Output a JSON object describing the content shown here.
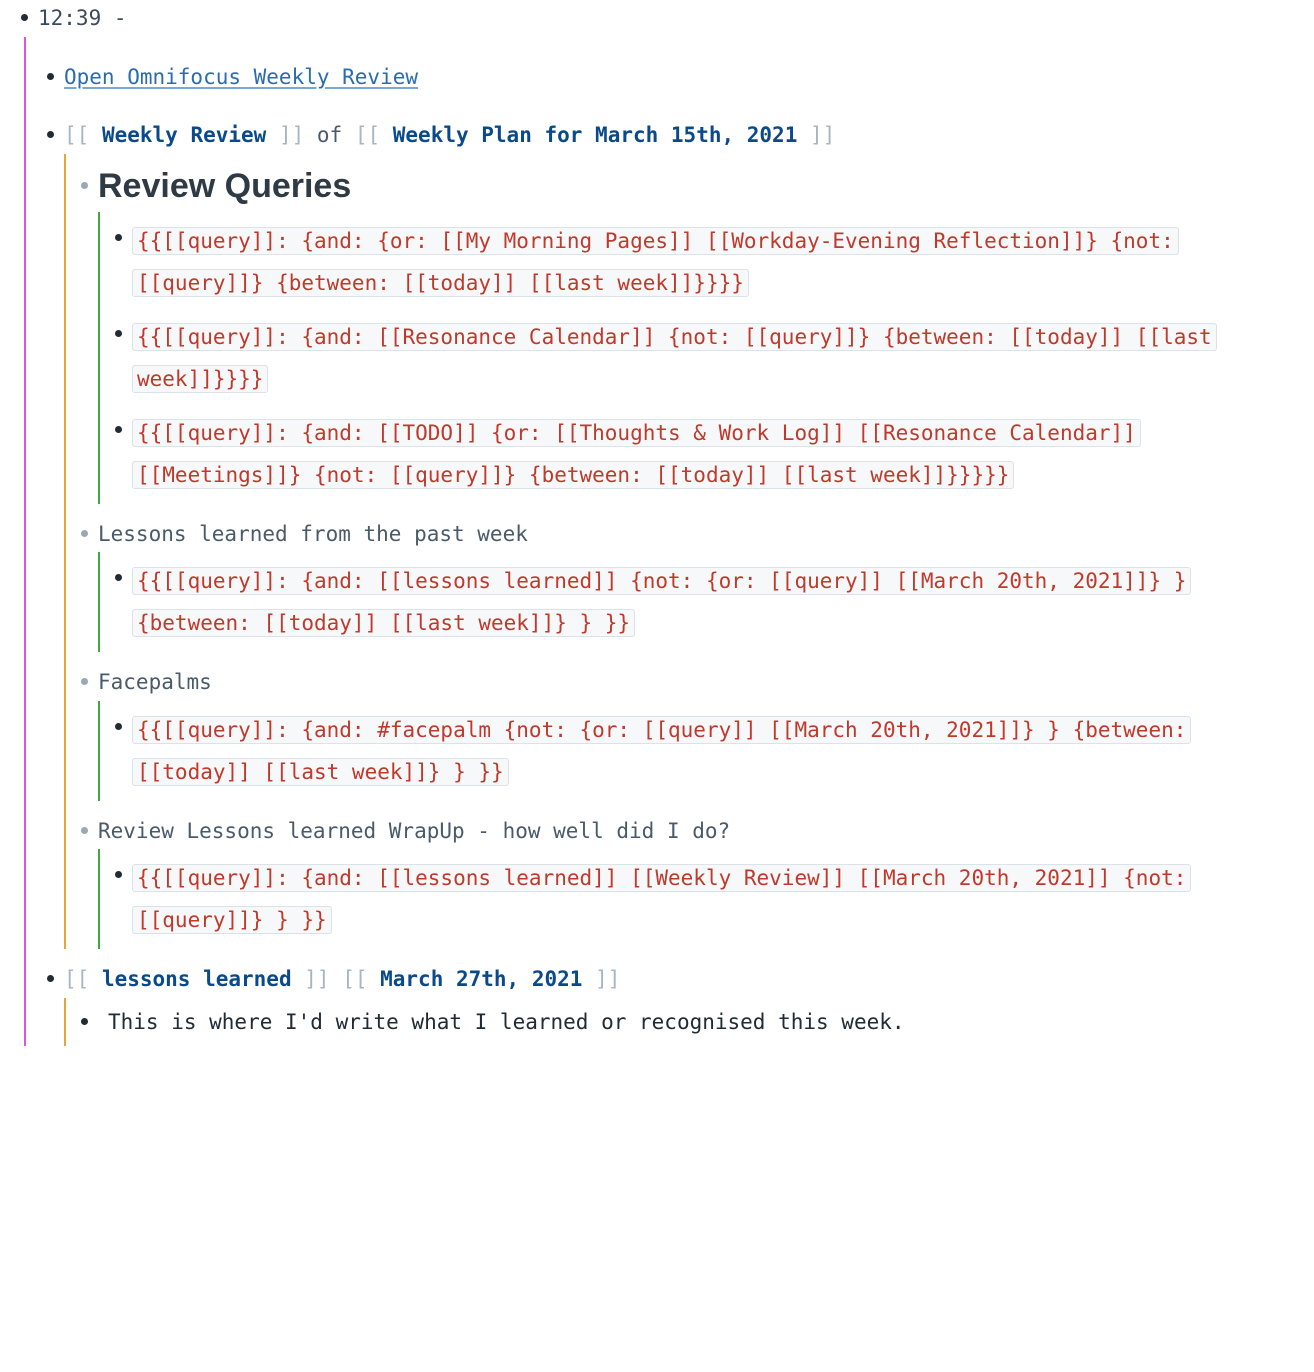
{
  "root": {
    "timestamp": "12:39",
    "sep": " - "
  },
  "items": {
    "omnifocus_link": "Open Omnifocus Weekly Review",
    "weekly_review_link": "Weekly Review",
    "of_word": " of ",
    "weekly_plan_link": "Weekly Plan for March 15th, 2021",
    "review_queries_heading": "Review Queries",
    "query1": "{{[[query]]: {and: {or: [[My Morning Pages]] [[Workday-Evening Reflection]]} {not: [[query]]} {between: [[today]] [[last week]]}}}}",
    "query2": "{{[[query]]: {and: [[Resonance Calendar]] {not: [[query]]} {between: [[today]] [[last week]]}}}}",
    "query3": "{{[[query]]: {and: [[TODO]] {or: [[Thoughts & Work Log]] [[Resonance Calendar]] [[Meetings]]} {not: [[query]]} {between: [[today]] [[last week]]}}}}}",
    "lessons_heading": "Lessons learned from the past week",
    "query4": "{{[[query]]: {and: [[lessons learned]]  {not: {or: [[query]] [[March 20th, 2021]]} } {between: [[today]] [[last week]]} } }}",
    "facepalms_heading": "Facepalms",
    "query5": "{{[[query]]: {and: #facepalm {not: {or: [[query]] [[March 20th, 2021]]} } {between: [[today]] [[last week]]} } }}",
    "wrapup_heading": "Review Lessons learned WrapUp - how well did I do?",
    "query6": "{{[[query]]: {and: [[lessons learned]] [[Weekly Review]] [[March 20th, 2021]] {not:[[query]]} } }}",
    "lessons_learned_link": "lessons learned",
    "date_link": "March 27th, 2021",
    "note_text": "This is where I'd write what I learned or recognised this week."
  },
  "brackets": {
    "open": "[[ ",
    "close": " ]]"
  }
}
